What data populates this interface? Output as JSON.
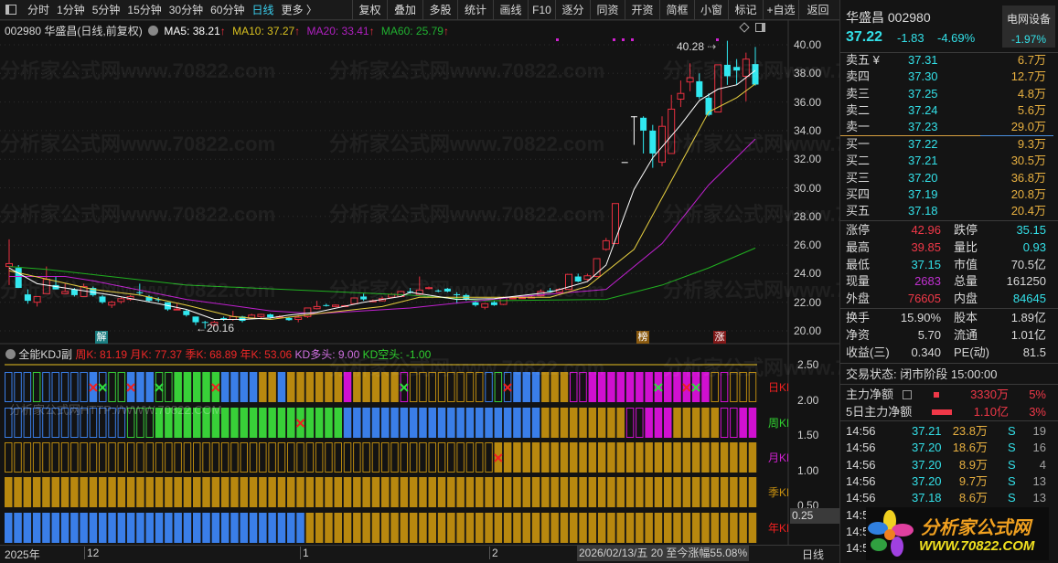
{
  "toolbar": {
    "tabs": [
      "分时",
      "1分钟",
      "5分钟",
      "15分钟",
      "30分钟",
      "60分钟",
      "日线",
      "更多 〉"
    ],
    "active": "日线",
    "buttons": [
      "复权",
      "叠加",
      "多股",
      "统计",
      "画线",
      "F10",
      "逐分",
      "同资",
      "开资",
      "简框",
      "小窗",
      "标记",
      "+自选",
      "返回"
    ]
  },
  "header": {
    "title": "002980 华盛昌(日线,前复权)",
    "ma5": "MA5: 38.21",
    "ma10": "MA10: 37.27",
    "ma20": "MA20: 33.41",
    "ma60": "MA60: 25.79",
    "arrow": "↑"
  },
  "watermark": "分析家公式网www.70822.com",
  "watermark2": "分析家公式网HTTP://WWW.70822.COM",
  "chart_labels": {
    "high": "40.28",
    "low": "←20.16",
    "badge1": "解",
    "badge2": "榜",
    "badge3": "涨"
  },
  "price_axis": [
    "40.00",
    "38.00",
    "36.00",
    "34.00",
    "32.00",
    "30.00",
    "28.00",
    "26.00",
    "24.00",
    "22.00",
    "20.00"
  ],
  "candles": [
    [
      24.5,
      26.4,
      23.2,
      24.7
    ],
    [
      24.4,
      24.6,
      23.0,
      23.0
    ],
    [
      22.55,
      22.9,
      21.9,
      22.1
    ],
    [
      22.0,
      22.4,
      21.7,
      22.4
    ],
    [
      22.6,
      24.5,
      22.6,
      23.6
    ],
    [
      23.2,
      23.8,
      22.9,
      22.9
    ],
    [
      22.6,
      23.3,
      22.6,
      22.75
    ],
    [
      22.9,
      23.0,
      22.4,
      22.5
    ],
    [
      22.4,
      23.3,
      22.4,
      23.1
    ],
    [
      23.0,
      23.1,
      22.4,
      22.5
    ],
    [
      22.4,
      22.5,
      21.9,
      22.0
    ],
    [
      21.8,
      22.1,
      21.6,
      22.0
    ],
    [
      22.05,
      22.35,
      21.9,
      22.25
    ],
    [
      22.2,
      22.5,
      22.1,
      22.4
    ],
    [
      22.7,
      23.3,
      22.5,
      22.68
    ],
    [
      22.4,
      22.5,
      22.0,
      22.1
    ],
    [
      22.2,
      22.35,
      22.0,
      22.18
    ],
    [
      22.0,
      22.0,
      21.4,
      21.5
    ],
    [
      21.5,
      21.9,
      21.5,
      21.52
    ],
    [
      21.4,
      21.5,
      21.0,
      21.1
    ],
    [
      21.0,
      21.0,
      20.4,
      20.6
    ],
    [
      20.62,
      20.7,
      20.16,
      20.6
    ],
    [
      20.4,
      20.7,
      20.3,
      20.6
    ],
    [
      20.9,
      21.0,
      20.7,
      20.88
    ],
    [
      20.8,
      21.4,
      20.7,
      21.0
    ],
    [
      21.0,
      21.05,
      20.6,
      20.7
    ],
    [
      20.9,
      21.2,
      20.8,
      21.1
    ],
    [
      21.0,
      21.2,
      20.9,
      21.15
    ],
    [
      21.15,
      21.2,
      20.85,
      20.95
    ],
    [
      20.98,
      21.1,
      20.9,
      21.0
    ],
    [
      20.9,
      20.95,
      20.7,
      20.75
    ],
    [
      20.8,
      21.1,
      20.6,
      20.95
    ],
    [
      21.0,
      21.6,
      20.9,
      21.6
    ],
    [
      21.55,
      22.1,
      21.5,
      21.7
    ],
    [
      21.8,
      21.9,
      21.7,
      21.78
    ],
    [
      21.7,
      21.85,
      21.65,
      21.8
    ],
    [
      21.74,
      21.8,
      21.7,
      21.76
    ],
    [
      21.9,
      22.3,
      21.85,
      22.3
    ],
    [
      22.4,
      22.6,
      22.1,
      22.2
    ],
    [
      22.08,
      22.2,
      22.0,
      22.1
    ],
    [
      22.1,
      22.4,
      22.05,
      22.25
    ],
    [
      22.35,
      22.65,
      22.3,
      22.55
    ],
    [
      22.4,
      22.8,
      22.35,
      22.75
    ],
    [
      22.76,
      23.0,
      22.6,
      22.74
    ],
    [
      22.55,
      23.8,
      22.5,
      22.85
    ],
    [
      23.0,
      23.1,
      22.9,
      23.02
    ],
    [
      22.82,
      22.9,
      22.7,
      22.8
    ],
    [
      22.95,
      23.0,
      22.7,
      22.75
    ],
    [
      22.56,
      22.7,
      21.9,
      22.54
    ],
    [
      22.5,
      22.6,
      22.1,
      22.2
    ],
    [
      22.0,
      22.05,
      21.7,
      21.8
    ],
    [
      21.65,
      21.95,
      21.5,
      21.9
    ],
    [
      22.0,
      22.1,
      21.75,
      21.8
    ],
    [
      21.85,
      22.4,
      21.8,
      22.3
    ],
    [
      22.28,
      22.4,
      22.2,
      22.3
    ],
    [
      22.3,
      22.4,
      22.25,
      22.32
    ],
    [
      22.34,
      22.5,
      22.3,
      22.36
    ],
    [
      22.45,
      22.9,
      22.4,
      22.75
    ],
    [
      22.82,
      23.0,
      22.7,
      22.8
    ],
    [
      22.7,
      23.0,
      22.65,
      22.9
    ],
    [
      22.9,
      23.95,
      22.85,
      23.95
    ],
    [
      23.8,
      24.0,
      23.4,
      23.45
    ],
    [
      23.6,
      24.0,
      23.5,
      23.85
    ],
    [
      23.8,
      25.05,
      23.75,
      25.05
    ],
    [
      25.7,
      26.5,
      25.6,
      26.3
    ],
    [
      26.1,
      28.9,
      26.1,
      28.9
    ],
    [
      31.8,
      31.8,
      31.8,
      31.8
    ],
    [
      35.0,
      35.0,
      33.0,
      35.0
    ],
    [
      34.9,
      35.0,
      32.4,
      34.0
    ],
    [
      34.0,
      34.4,
      31.4,
      32.4
    ],
    [
      31.8,
      35.0,
      31.5,
      34.3
    ],
    [
      32.4,
      36.5,
      32.4,
      35.5
    ],
    [
      36.2,
      37.5,
      35.65,
      36.6
    ],
    [
      37.4,
      38.7,
      36.75,
      37.7
    ],
    [
      37.45,
      38.0,
      36.2,
      36.35
    ],
    [
      36.3,
      36.6,
      35.0,
      35.1
    ],
    [
      35.3,
      38.6,
      35.3,
      38.6
    ],
    [
      38.6,
      40.28,
      37.2,
      37.8
    ],
    [
      38.45,
      39.0,
      37.2,
      38.2
    ],
    [
      37.8,
      39.45,
      36.05,
      39.0
    ],
    [
      38.65,
      39.85,
      37.15,
      37.22
    ]
  ],
  "ma": {
    "ma5": [
      [
        0,
        24.4
      ],
      [
        3,
        23.3
      ],
      [
        7,
        22.9
      ],
      [
        11,
        22.5
      ],
      [
        16,
        21.9
      ],
      [
        19,
        21.5
      ],
      [
        22,
        20.8
      ],
      [
        25,
        20.8
      ],
      [
        28,
        20.9
      ],
      [
        30,
        21.1
      ],
      [
        33,
        21.3
      ],
      [
        38,
        22.0
      ],
      [
        42,
        22.4
      ],
      [
        43,
        22.7
      ],
      [
        48,
        22.2
      ],
      [
        52,
        22.25
      ],
      [
        58,
        22.7
      ],
      [
        62,
        23.45
      ],
      [
        64,
        24.6
      ],
      [
        67,
        29.9
      ],
      [
        69,
        32.1
      ],
      [
        72,
        34.4
      ],
      [
        74,
        36.1
      ],
      [
        76,
        36.9
      ],
      [
        78,
        37.2
      ],
      [
        80,
        38.21
      ]
    ],
    "ma10": [
      [
        0,
        24.2
      ],
      [
        9,
        22.9
      ],
      [
        14,
        22.5
      ],
      [
        19,
        21.8
      ],
      [
        24,
        21.0
      ],
      [
        28,
        20.8
      ],
      [
        33,
        21.2
      ],
      [
        40,
        21.7
      ],
      [
        44,
        22.35
      ],
      [
        58,
        22.35
      ],
      [
        62,
        23.1
      ],
      [
        67,
        25.7
      ],
      [
        70,
        29.3
      ],
      [
        73,
        32.9
      ],
      [
        75,
        35.3
      ],
      [
        78,
        36.3
      ],
      [
        80,
        37.27
      ]
    ],
    "ma20": [
      [
        0,
        23.8
      ],
      [
        6,
        23.8
      ],
      [
        9,
        23.5
      ],
      [
        19,
        22.2
      ],
      [
        28,
        21.4
      ],
      [
        33,
        21.2
      ],
      [
        43,
        21.6
      ],
      [
        54,
        22.35
      ],
      [
        64,
        22.9
      ],
      [
        70,
        26.1
      ],
      [
        75,
        30.2
      ],
      [
        80,
        33.41
      ]
    ],
    "ma60": [
      [
        0,
        24.5
      ],
      [
        4,
        24.3
      ],
      [
        19,
        23.2
      ],
      [
        43,
        22.5
      ],
      [
        51,
        22.1
      ],
      [
        64,
        22.2
      ],
      [
        70,
        23.2
      ],
      [
        75,
        24.4
      ],
      [
        80,
        25.79
      ]
    ]
  },
  "colors": {
    "ma5": "#ffffff",
    "ma10": "#e8d040",
    "ma20": "#c020d0",
    "ma60": "#20b020",
    "up": "#e83040",
    "down": "#30e8f0",
    "B": "#3a7ee8",
    "G": "#38d038",
    "Y": "#b8880f",
    "M": "#d010d0"
  },
  "kdj": {
    "title": "全能KDJ副",
    "week": "周K: 81.19",
    "month": "月K: 77.37",
    "season": "季K: 68.89",
    "year": "年K: 53.06",
    "bull": "KD多头: 9.00",
    "bear": "KD空头: -1.00",
    "rows": [
      {
        "label": "日KD",
        "states": "bbbgbbbbbBbggBBBggGGGGGBBBBYYBYYYYYYMYYYYYmyyyyyyyybgbBBBYYYmmMMMMMMMMMMMMMymyyy",
        "cross_red": [
          9,
          13,
          22,
          53,
          72
        ],
        "cross_green": [
          10,
          16,
          42,
          69,
          73
        ]
      },
      {
        "label": "周KD",
        "states": "bbbbbbbbbbbbbgggGGGGGGGGGGGGGGGGGGGGBBBBBBBBBBBBBBBBBBBBBYYYYYYYYYmmMMMYYYYYmmMM",
        "cross_red": [
          31
        ],
        "cross_green": []
      },
      {
        "label": "月KD",
        "states": "yyyyyyyyyyyyyyyyyyyyyyyyyyyyyyyyyyyyyyyyyyyyyyyyyyyyYYYYYYYYYYYYYYYYYYYYYYYYYYYY",
        "cross_red": [
          52
        ],
        "cross_green": []
      },
      {
        "label": "季KD",
        "states": "YYYYYYYYYYYYYYYYYYYYYYYYYYYYYYYYYYYYYYYYYYYYYYYYYYYYYYYYYYYYYYYYYYYYYYYYYYYYYYYY",
        "cross_red": [],
        "cross_green": []
      },
      {
        "label": "年KD",
        "states": "BBBBBBBBBBBBBBBBBBBBBBBBBBBBBBBBYYYYYYYYYYYYYYYYYYYYYYYYYYYYYYYYYYYYYYYYYYYYYYYY",
        "cross_red": [],
        "cross_green": []
      }
    ],
    "axis": [
      "2.50",
      "2.00",
      "1.50",
      "1.00",
      "0.50"
    ],
    "cursor_value": "0.25"
  },
  "time_axis": {
    "labels": [
      "2025年",
      "12",
      "1",
      "2"
    ],
    "info": "2026/02/13/五 20 至今涨幅55.08%",
    "period": "日线"
  },
  "quote": {
    "name": "华盛昌 002980",
    "sector": "电网设备",
    "sector_change": "-1.97%",
    "price": "37.22",
    "change": "-1.83",
    "pct": "-4.69%",
    "asks": [
      [
        "卖五 ¥",
        "37.31",
        "6.7万"
      ],
      [
        "卖四",
        "37.30",
        "12.7万"
      ],
      [
        "卖三",
        "37.25",
        "4.8万"
      ],
      [
        "卖二",
        "37.24",
        "5.6万"
      ],
      [
        "卖一",
        "37.23",
        "29.0万"
      ]
    ],
    "bids": [
      [
        "买一",
        "37.22",
        "9.3万"
      ],
      [
        "买二",
        "37.21",
        "30.5万"
      ],
      [
        "买三",
        "37.20",
        "36.8万"
      ],
      [
        "买四",
        "37.19",
        "20.8万"
      ],
      [
        "买五",
        "37.18",
        "20.4万"
      ]
    ],
    "stats1": [
      [
        "涨停",
        "42.96",
        "rd",
        "跌停",
        "35.15",
        "cy"
      ],
      [
        "最高",
        "39.85",
        "rd",
        "量比",
        "0.93",
        "cy"
      ],
      [
        "最低",
        "37.15",
        "cy",
        "市值",
        "70.5亿",
        "wh"
      ],
      [
        "现量",
        "2683",
        "mg",
        "总量",
        "161250",
        "wh"
      ],
      [
        "外盘",
        "76605",
        "rd",
        "内盘",
        "84645",
        "cy"
      ]
    ],
    "stats2": [
      [
        "换手",
        "15.90%",
        "股本",
        "1.89亿"
      ],
      [
        "净资",
        "5.70",
        "流通",
        "1.01亿"
      ],
      [
        "收益(三)",
        "0.340",
        "PE(动)",
        "81.5"
      ]
    ],
    "status": "交易状态: 闭市阶段 15:00:00",
    "flow": [
      [
        "主力净额",
        "3330万",
        "5%"
      ],
      [
        "5日主力净额",
        "1.10亿",
        "3%"
      ]
    ],
    "trades": [
      [
        "14:56",
        "37.21",
        "23.8万",
        "S",
        "19"
      ],
      [
        "14:56",
        "37.20",
        "18.6万",
        "S",
        "16"
      ],
      [
        "14:56",
        "37.20",
        "8.9万",
        "S",
        "4"
      ],
      [
        "14:56",
        "37.20",
        "9.7万",
        "S",
        "13"
      ],
      [
        "14:56",
        "37.18",
        "8.6万",
        "S",
        "13"
      ],
      [
        "14:56",
        "",
        "",
        "",
        ""
      ],
      [
        "14:56",
        "",
        "",
        "",
        ""
      ],
      [
        "14:56",
        "",
        "",
        "",
        ""
      ]
    ],
    "logo_cn": "分析家公式网",
    "logo_url": "WWW.70822.COM"
  }
}
